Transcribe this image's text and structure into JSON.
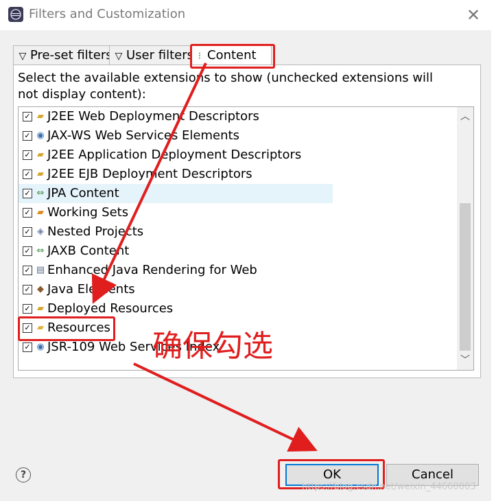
{
  "window": {
    "title": "Filters and Customization",
    "close_icon": "close-icon"
  },
  "tabs": [
    {
      "label": "Pre-set filters",
      "icon": "filter-icon"
    },
    {
      "label": "User filters",
      "icon": "filter-icon"
    },
    {
      "label": "Content",
      "icon": "content-icon",
      "active": true
    }
  ],
  "description": "Select the available extensions to show (unchecked extensions will not display content):",
  "extensions": [
    {
      "label": "J2EE Web Deployment Descriptors",
      "checked": true,
      "icon": "folder-icon"
    },
    {
      "label": "JAX-WS Web Services Elements",
      "checked": true,
      "icon": "webservice-icon"
    },
    {
      "label": "J2EE Application Deployment Descriptors",
      "checked": true,
      "icon": "folder-icon"
    },
    {
      "label": "J2EE EJB Deployment Descriptors",
      "checked": true,
      "icon": "folder-icon"
    },
    {
      "label": "JPA Content",
      "checked": true,
      "icon": "jpa-icon",
      "highlighted": true
    },
    {
      "label": "Working Sets",
      "checked": true,
      "icon": "working-sets-icon"
    },
    {
      "label": "Nested Projects",
      "checked": true,
      "icon": "nested-projects-icon"
    },
    {
      "label": "JAXB Content",
      "checked": true,
      "icon": "jaxb-icon"
    },
    {
      "label": "Enhanced Java Rendering for Web",
      "checked": true,
      "icon": "java-file-icon"
    },
    {
      "label": "Java Elements",
      "checked": true,
      "icon": "java-elements-icon"
    },
    {
      "label": "Deployed Resources",
      "checked": true,
      "icon": "folder-icon"
    },
    {
      "label": "Resources",
      "checked": true,
      "icon": "resources-icon"
    },
    {
      "label": "JSR-109 Web Services Index",
      "checked": true,
      "icon": "webservice-icon"
    }
  ],
  "buttons": {
    "ok": "OK",
    "cancel": "Cancel",
    "help": "?"
  },
  "annotation": {
    "text": "确保勾选",
    "color": "#e01e1e"
  },
  "watermark": "https://blog.csdn.net/weixin_44660003",
  "colors": {
    "annotation_red": "#e01e1e",
    "ok_border": "#0078d7",
    "highlight_row": "#e5f3fb"
  }
}
